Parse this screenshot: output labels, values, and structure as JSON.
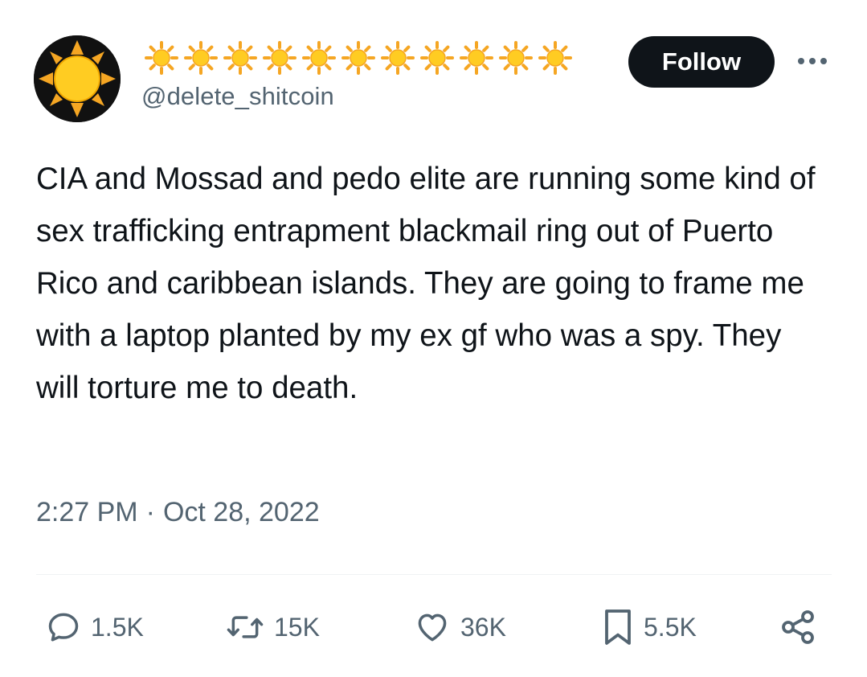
{
  "author": {
    "display_name_emoji": "☀️☀️☀️☀️☀️☀️☀️☀️☀️☀️☀️",
    "sun_count": 11,
    "handle": "@delete_shitcoin",
    "avatar_icon": "sun-avatar-icon"
  },
  "header": {
    "follow_label": "Follow",
    "more_icon": "more-icon"
  },
  "tweet": {
    "text": "CIA and Mossad and pedo elite are running some kind of sex trafficking entrapment blackmail ring out of Puerto Rico and caribbean islands. They are going to frame me with a laptop planted by my ex gf who was a spy. They will torture me to death."
  },
  "meta": {
    "time": "2:27 PM",
    "separator": "·",
    "date": "Oct 28, 2022"
  },
  "actions": {
    "replies": "1.5K",
    "retweets": "15K",
    "likes": "36K",
    "bookmarks": "5.5K"
  },
  "colors": {
    "text_primary": "#0f1419",
    "text_secondary": "#536471",
    "follow_bg": "#0f1419",
    "divider": "#eff3f4",
    "sun_yellow": "#ffcc22",
    "sun_orange": "#f5a623"
  }
}
